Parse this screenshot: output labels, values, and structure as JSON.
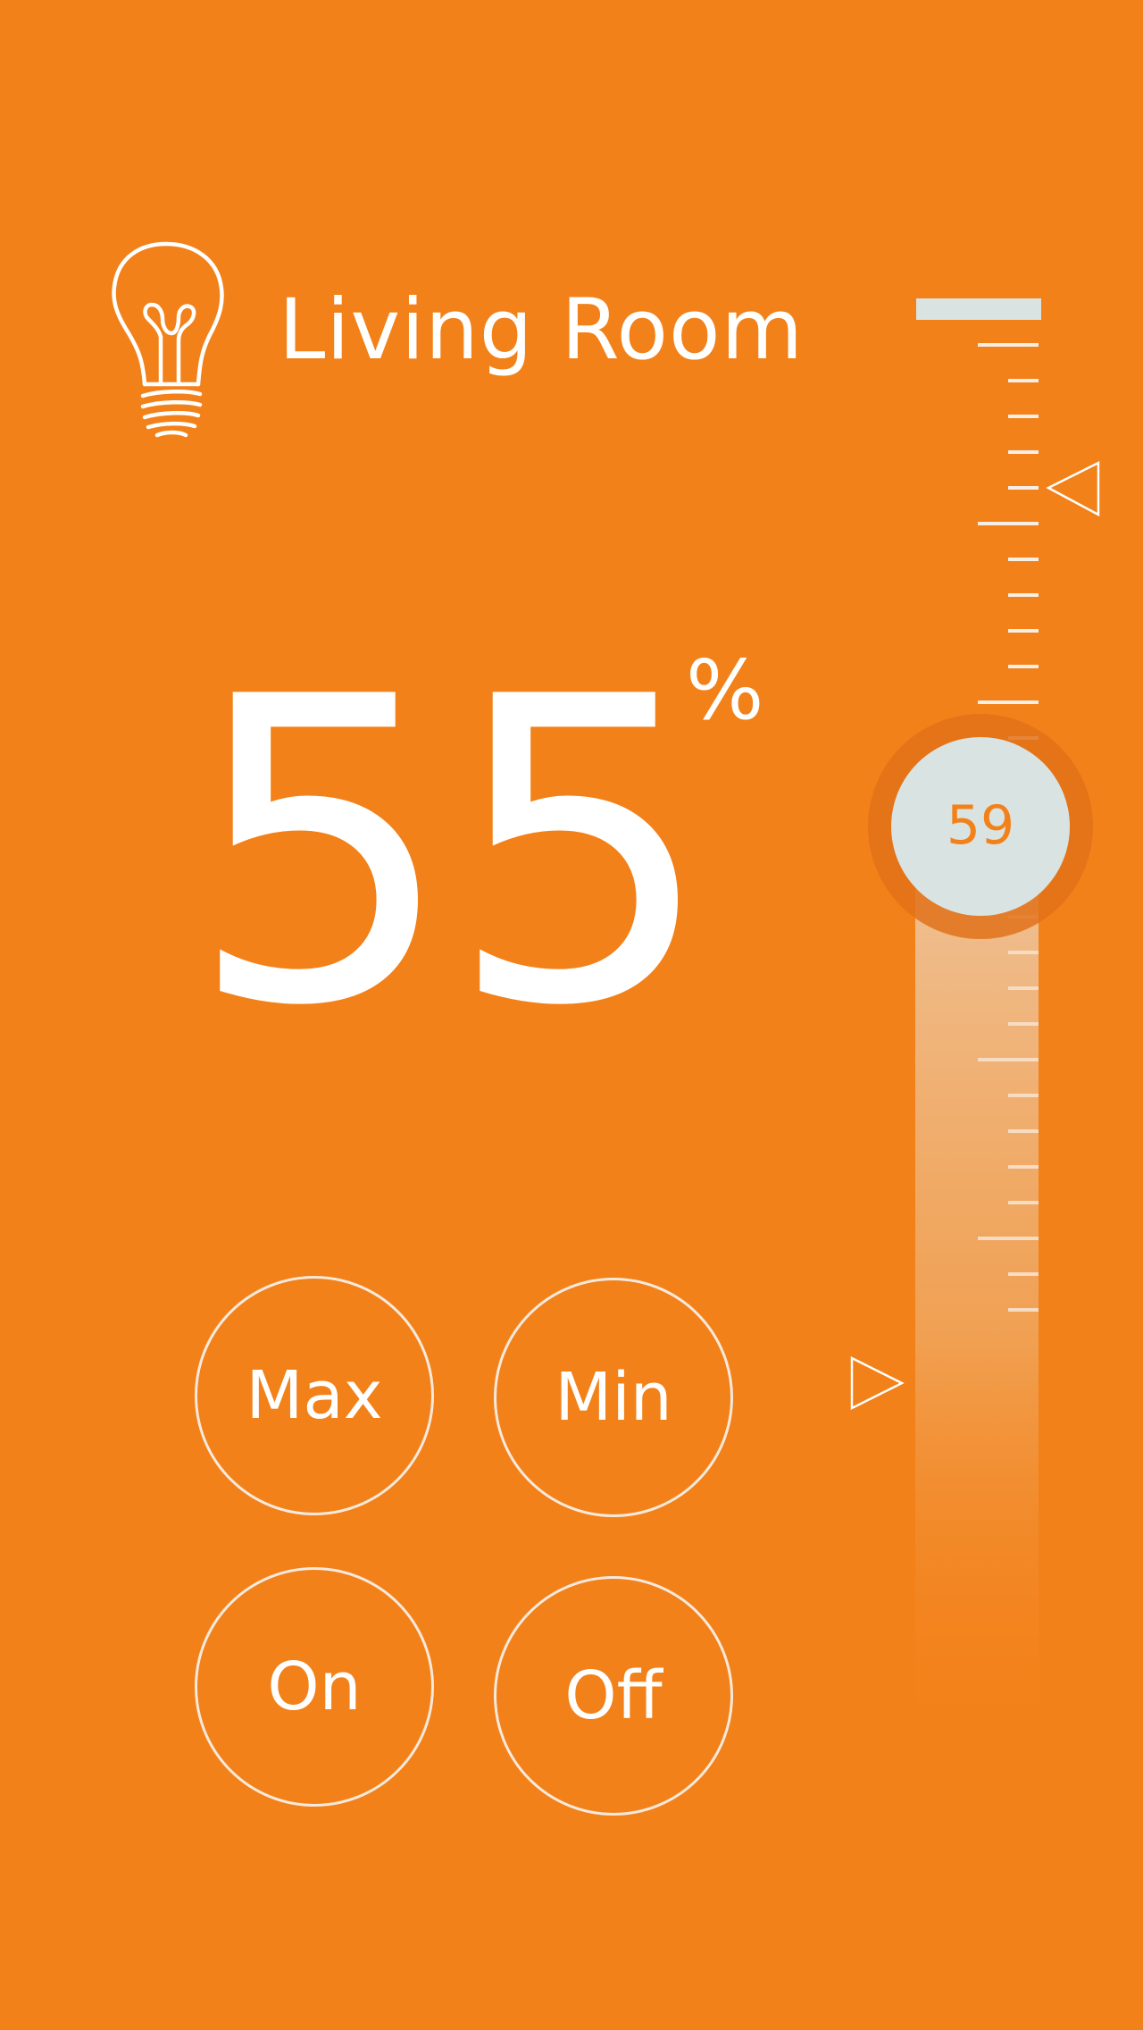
{
  "header": {
    "room_name": "Living Room",
    "icon": "lightbulb-icon"
  },
  "brightness": {
    "value": "55",
    "unit": "%"
  },
  "buttons": {
    "max_label": "Max",
    "min_label": "Min",
    "on_label": "On",
    "off_label": "Off"
  },
  "slider": {
    "knob_value": "59",
    "level_percent": 59,
    "upper_marker_icon": "triangle-left-icon",
    "lower_marker_icon": "triangle-right-icon"
  },
  "colors": {
    "background": "#f38119",
    "foreground": "#ffffff",
    "knob": "#d9e3e2",
    "knob_text": "#f38119"
  }
}
